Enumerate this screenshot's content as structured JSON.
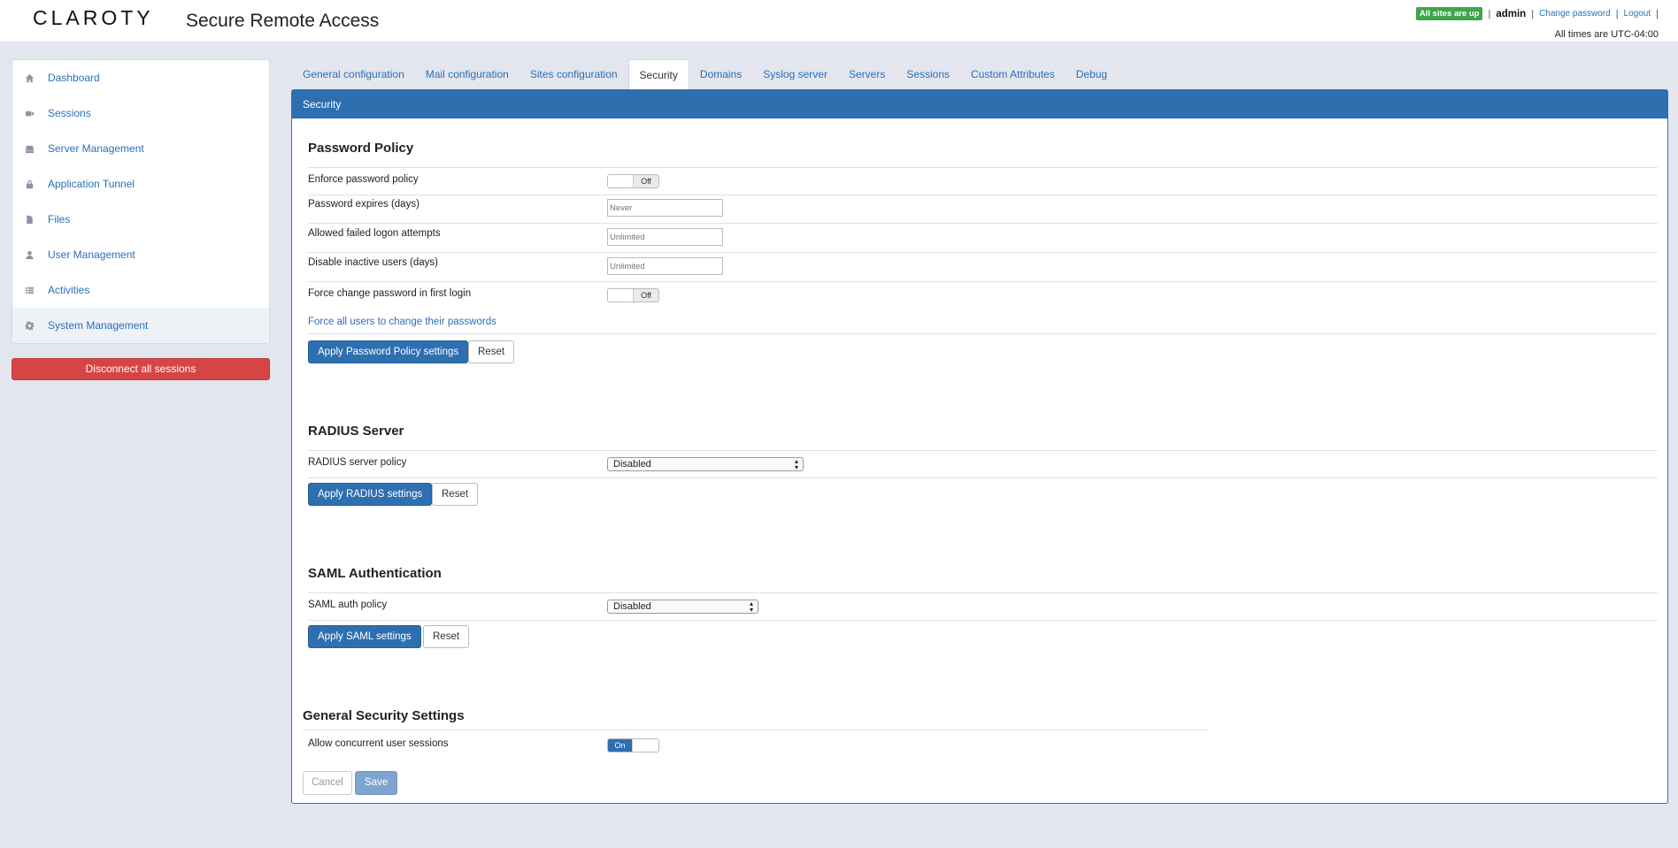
{
  "header": {
    "logo": "CLAROTY",
    "title": "Secure Remote Access",
    "status_badge": "All sites are up",
    "user": "admin",
    "change_password": "Change password",
    "logout": "Logout",
    "timezone": "All times are UTC-04:00",
    "separator": "|"
  },
  "sidebar": {
    "items": [
      {
        "label": "Dashboard",
        "icon": "home-icon"
      },
      {
        "label": "Sessions",
        "icon": "video-icon"
      },
      {
        "label": "Server Management",
        "icon": "server-icon"
      },
      {
        "label": "Application Tunnel",
        "icon": "lock-icon"
      },
      {
        "label": "Files",
        "icon": "file-icon"
      },
      {
        "label": "User Management",
        "icon": "user-icon"
      },
      {
        "label": "Activities",
        "icon": "list-icon"
      },
      {
        "label": "System Management",
        "icon": "gear-icon",
        "active": true
      }
    ],
    "disconnect_label": "Disconnect all sessions"
  },
  "tabs": [
    {
      "label": "General configuration"
    },
    {
      "label": "Mail configuration"
    },
    {
      "label": "Sites configuration"
    },
    {
      "label": "Security",
      "active": true
    },
    {
      "label": "Domains"
    },
    {
      "label": "Syslog server"
    },
    {
      "label": "Servers"
    },
    {
      "label": "Sessions"
    },
    {
      "label": "Custom Attributes"
    },
    {
      "label": "Debug"
    }
  ],
  "panel": {
    "title": "Security",
    "password_policy": {
      "title": "Password Policy",
      "enforce_label": "Enforce password policy",
      "enforce_state": "Off",
      "expires_label": "Password expires (days)",
      "expires_placeholder": "Never",
      "failed_label": "Allowed failed logon attempts",
      "failed_placeholder": "Unlimited",
      "inactive_label": "Disable inactive users (days)",
      "inactive_placeholder": "Unlimited",
      "force_first_label": "Force change password in first login",
      "force_first_state": "Off",
      "force_all_link": "Force all users to change their passwords",
      "apply_label": "Apply Password Policy settings",
      "reset_label": "Reset"
    },
    "radius": {
      "title": "RADIUS Server",
      "policy_label": "RADIUS server policy",
      "policy_value": "Disabled",
      "apply_label": "Apply RADIUS settings",
      "reset_label": "Reset"
    },
    "saml": {
      "title": "SAML Authentication",
      "policy_label": "SAML auth policy",
      "policy_value": "Disabled",
      "apply_label": "Apply SAML settings",
      "reset_label": "Reset"
    },
    "general": {
      "title": "General Security Settings",
      "concurrent_label": "Allow concurrent user sessions",
      "concurrent_state": "On",
      "cancel_label": "Cancel",
      "save_label": "Save"
    }
  },
  "colors": {
    "accent": "#2e6fb0",
    "link": "#2a6fba",
    "danger": "#d64545",
    "success": "#3ea54a",
    "background": "#e3e6ee"
  }
}
